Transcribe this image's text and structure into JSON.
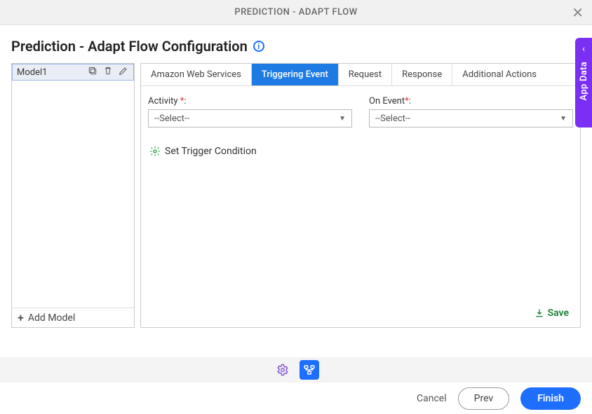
{
  "header": {
    "title": "PREDICTION - ADAPT FLOW"
  },
  "page": {
    "title": "Prediction - Adapt Flow Configuration"
  },
  "sidebar": {
    "models": [
      {
        "name": "Model1"
      }
    ],
    "add_label": "Add Model"
  },
  "tabs": [
    {
      "label": "Amazon Web Services",
      "active": false
    },
    {
      "label": "Triggering Event",
      "active": true
    },
    {
      "label": "Request",
      "active": false
    },
    {
      "label": "Response",
      "active": false
    },
    {
      "label": "Additional Actions",
      "active": false
    }
  ],
  "form": {
    "activity": {
      "label": "Activity ",
      "required_mark": "*",
      "label_suffix": ":",
      "value": "--Select--"
    },
    "on_event": {
      "label": "On Event",
      "required_mark": "*",
      "label_suffix": ":",
      "value": "--Select--"
    },
    "trigger_condition_label": "Set Trigger Condition"
  },
  "actions": {
    "save": "Save"
  },
  "side_panel": {
    "label": "App Data"
  },
  "footer": {
    "cancel": "Cancel",
    "prev": "Prev",
    "finish": "Finish"
  }
}
